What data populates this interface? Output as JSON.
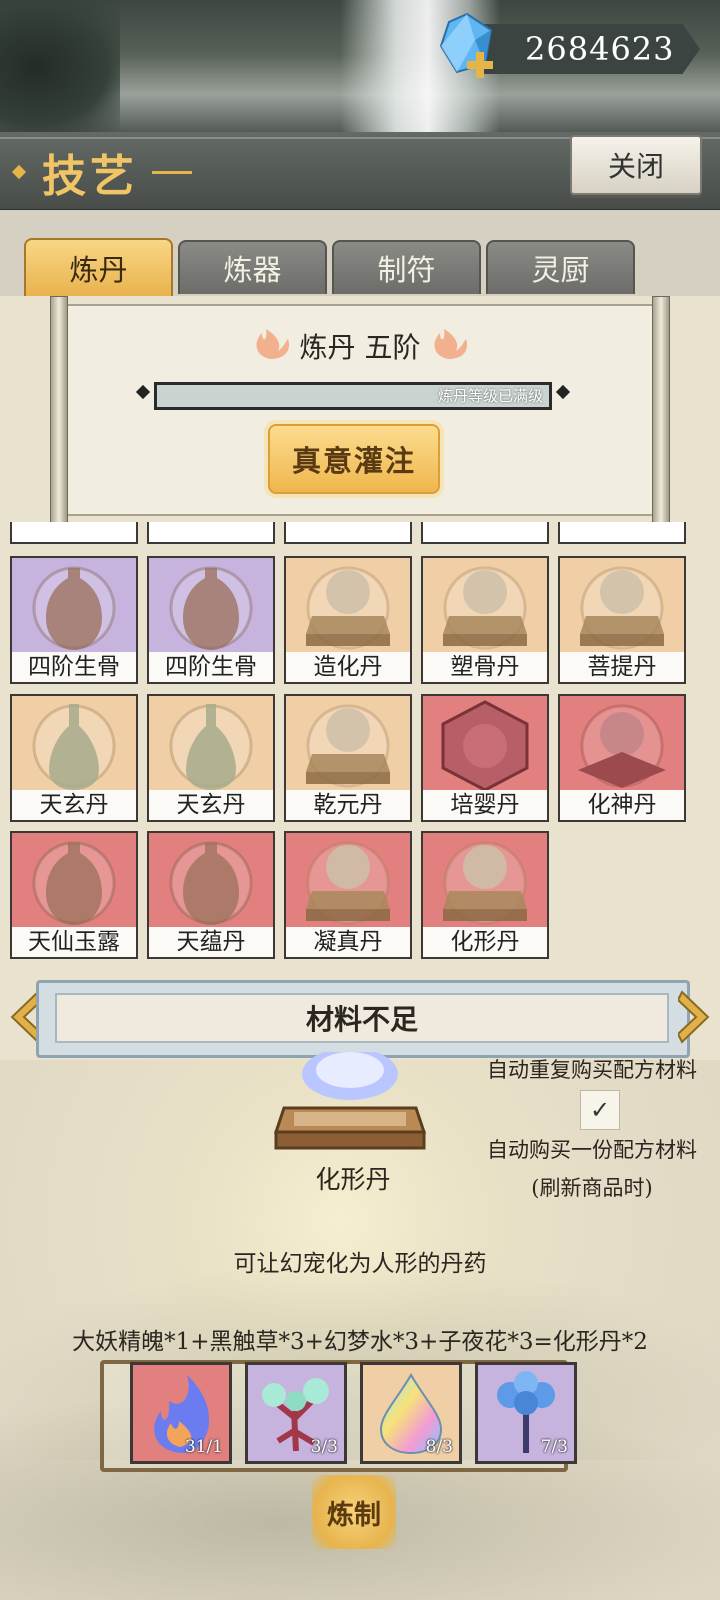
{
  "currency": {
    "amount": "2684623",
    "icon": "blue-crystal-icon",
    "add_icon": "plus-icon"
  },
  "header": {
    "title": "技艺",
    "close_label": "关闭"
  },
  "tabs": [
    {
      "label": "炼丹",
      "active": true
    },
    {
      "label": "炼器",
      "active": false
    },
    {
      "label": "制符",
      "active": false
    },
    {
      "label": "灵厨",
      "active": false
    }
  ],
  "skill": {
    "title": "炼丹 五阶",
    "progress_text": "炼丹等级已满级",
    "progress": 1.0,
    "infuse_label": "真意灌注"
  },
  "recipes": [
    {
      "name": "四阶生骨",
      "tier": "purple",
      "icon": "vase-icon"
    },
    {
      "name": "四阶生骨",
      "tier": "purple",
      "icon": "vase-icon"
    },
    {
      "name": "造化丹",
      "tier": "orange",
      "icon": "orb-stand-icon"
    },
    {
      "name": "塑骨丹",
      "tier": "orange",
      "icon": "orb-stand-icon"
    },
    {
      "name": "菩提丹",
      "tier": "orange",
      "icon": "orb-stand-icon"
    },
    {
      "name": "天玄丹",
      "tier": "orange",
      "icon": "bottle-icon"
    },
    {
      "name": "天玄丹",
      "tier": "orange",
      "icon": "bottle-icon"
    },
    {
      "name": "乾元丹",
      "tier": "orange",
      "icon": "orb-stand-icon"
    },
    {
      "name": "培婴丹",
      "tier": "red",
      "icon": "hexagon-icon"
    },
    {
      "name": "化神丹",
      "tier": "red",
      "icon": "orb-cushion-icon"
    },
    {
      "name": "天仙玉露",
      "tier": "red",
      "icon": "vase-icon"
    },
    {
      "name": "天蕴丹",
      "tier": "red",
      "icon": "vase-icon"
    },
    {
      "name": "凝真丹",
      "tier": "red",
      "icon": "orb-stand-icon"
    },
    {
      "name": "化形丹",
      "tier": "red",
      "icon": "orb-stand-icon"
    }
  ],
  "status": {
    "text": "材料不足"
  },
  "options": {
    "auto_repeat": "自动重复购买配方材料",
    "auto_repeat_checked": true,
    "checkmark": "✓",
    "auto_once_line1": "自动购买一份配方材料",
    "auto_once_line2": "(刷新商品时)"
  },
  "product": {
    "name": "化形丹",
    "description": "可让幻宠化为人形的丹药",
    "recipe": "大妖精魄*1+黑触草*3+幻梦水*3+子夜花*3=化形丹*2",
    "icon": "glowing-orb-icon"
  },
  "materials": [
    {
      "count": "31/1",
      "tier": "red",
      "icon": "blue-flame-icon"
    },
    {
      "count": "3/3",
      "tier": "purple",
      "icon": "tentacle-plant-icon"
    },
    {
      "count": "8/3",
      "tier": "orange",
      "icon": "rainbow-drop-icon"
    },
    {
      "count": "7/3",
      "tier": "purple",
      "icon": "blue-flower-icon"
    }
  ],
  "craft_label": "炼制",
  "colors": {
    "purple": "#c6b3de",
    "orange": "#f0cfa6",
    "red": "#e1807e",
    "accent": "#e9b24d"
  }
}
